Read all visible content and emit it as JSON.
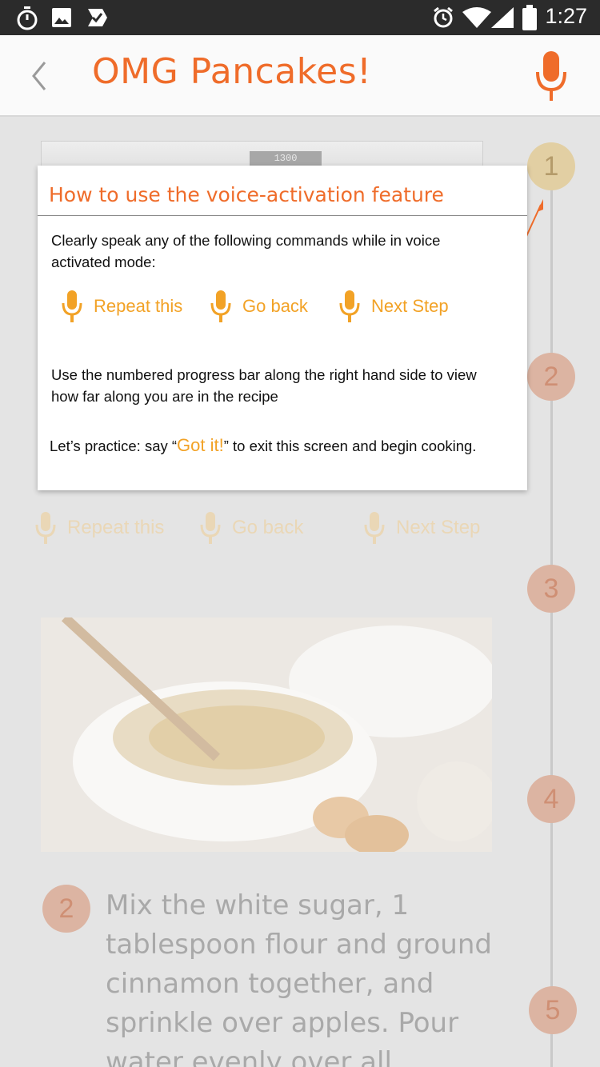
{
  "status_bar": {
    "time": "1:27",
    "left_icons": [
      "timer-icon",
      "image-icon",
      "check-icon"
    ],
    "right_icons": [
      "alarm-icon",
      "wifi-icon",
      "signal-icon",
      "battery-icon"
    ]
  },
  "app_bar": {
    "title": "OMG Pancakes!",
    "back_icon": "chevron-left-icon",
    "mic_icon": "microphone-icon"
  },
  "colors": {
    "accent": "#ef6c2a",
    "command": "#f2a226",
    "step_circle": "#dcb4a2",
    "step_active": "#e2cfa3"
  },
  "oven_display": "1300",
  "progress_steps": [
    "1",
    "2",
    "3",
    "4",
    "5"
  ],
  "active_step": "1",
  "background_commands": [
    "Repeat this",
    "Go back",
    "Next Step"
  ],
  "dialog": {
    "title": "How to use the voice-activation feature",
    "intro": "Clearly speak any of the following commands while in voice activated mode:",
    "commands": [
      "Repeat this",
      "Go back",
      "Next Step"
    ],
    "progress_hint": "Use the numbered progress bar along the right hand side to view how far along you are in the recipe",
    "practice_prefix": "Let’s practice: say “",
    "practice_command": "Got it!",
    "practice_suffix": "” to exit this screen and begin cooking."
  },
  "recipe_step": {
    "number": "2",
    "text": "Mix the white sugar, 1 tablespoon flour and ground cinnamon together, and sprinkle over apples. Pour water evenly over all"
  }
}
